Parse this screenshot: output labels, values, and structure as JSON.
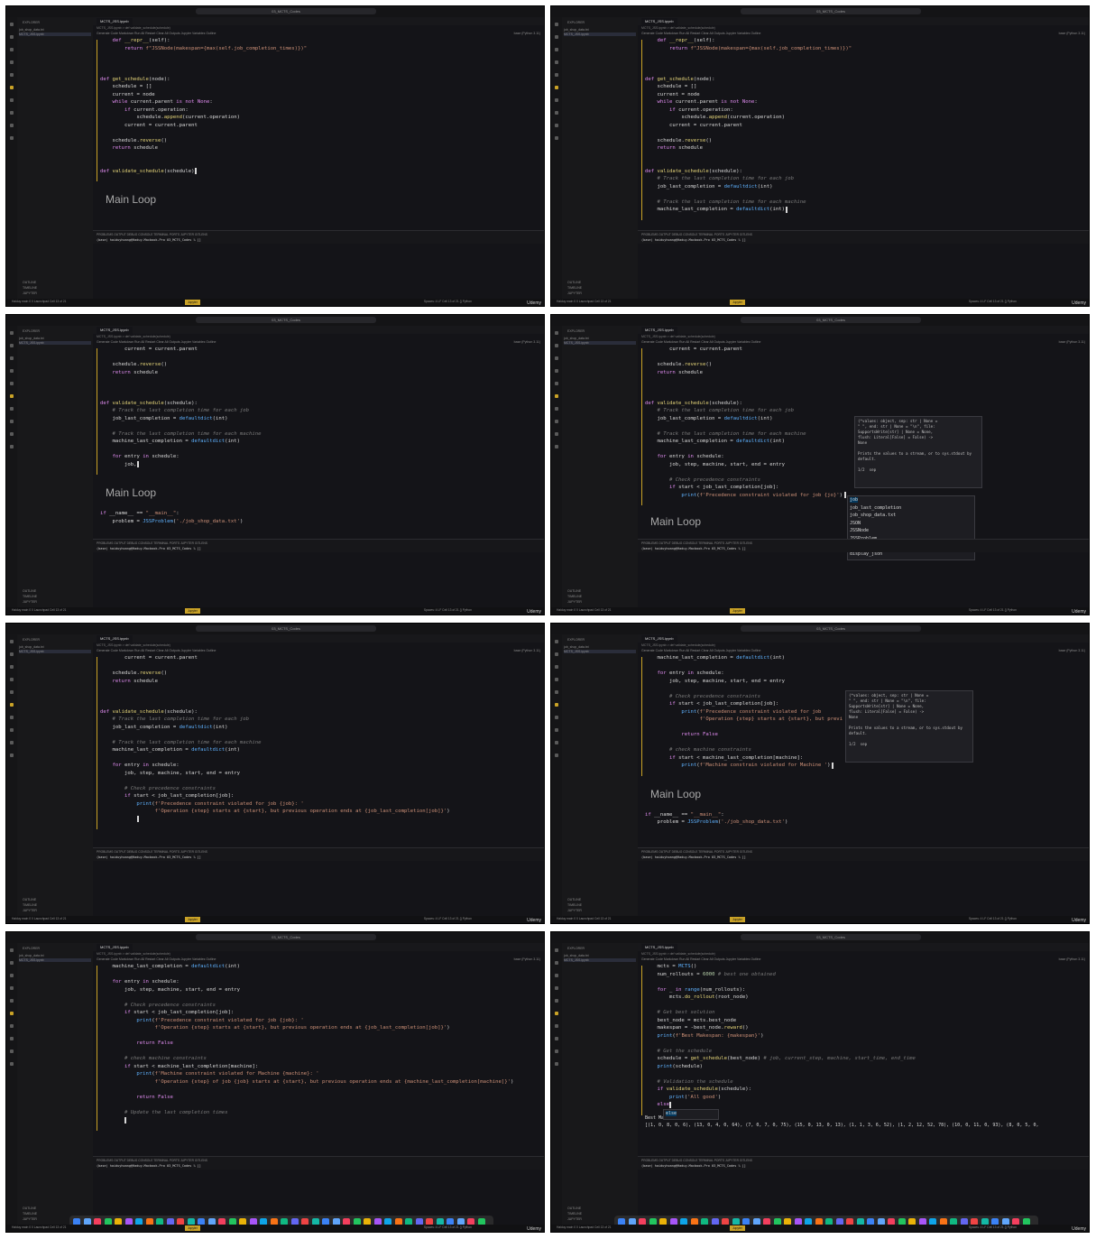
{
  "colors": {
    "accent": "#c9a227",
    "keyword": "#e08cf0",
    "function": "#e6d67a",
    "string": "#e6d67a",
    "comment": "#7a7a7a",
    "variable": "#8ec8f8",
    "builtin": "#5fb2ff"
  },
  "common": {
    "window_title": "03_MCTS_Codes",
    "file_tab": "MCTS_JSS.ipynb",
    "breadcrumb_1": "MCTS_JSS.ipynb > def validate_schedule(schedule)",
    "toolbar": "Generate  Code  Markdown  Run All  Restart  Clear All Outputs  Jupyter Variables  Outline",
    "kernel": "base (Python 3.11)",
    "explorer_title": "EXPLORER",
    "explorer_items": [
      "job_shop_data.txt",
      "MCTS_JSS.ipynb"
    ],
    "side_bottom": [
      "OUTLINE",
      "TIMELINE",
      "JUPYTER"
    ],
    "panel_tabs": "PROBLEMS  OUTPUT  DEBUG CONSOLE  TERMINAL  PORTS  JUPYTER  GITLENS",
    "terminal_prompt": "(base) haiduyhoang@Haduy-Macbook-Pro 03_MCTS_Codes % []",
    "status_left": "Haiduy  main  0  0  Launchpad  Cell 13 of 21",
    "status_badge": "Jupyter",
    "status_right": "Spaces: 4  LF  Cell 13 of 21  {} Python",
    "watermark": "Udemy",
    "markdown_heading": "Main Loop"
  },
  "frames": [
    {
      "lines": [
        "    def __repr__(self):",
        "        return f\"JSSNode(makespan={max(self.job_completion_times)})\"",
        "",
        "",
        "",
        "def get_schedule(node):",
        "    schedule = []",
        "    current = node",
        "    while current.parent is not None:",
        "        if current.operation:",
        "            schedule.append(current.operation)",
        "        current = current.parent",
        "",
        "    schedule.reverse()",
        "    return schedule",
        "",
        "",
        "def validate_schedule(schedule)"
      ]
    },
    {
      "lines": [
        "    def __repr__(self):",
        "        return f\"JSSNode(makespan={max(self.job_completion_times)})\"",
        "",
        "",
        "",
        "def get_schedule(node):",
        "    schedule = []",
        "    current = node",
        "    while current.parent is not None:",
        "        if current.operation:",
        "            schedule.append(current.operation)",
        "        current = current.parent",
        "",
        "    schedule.reverse()",
        "    return schedule",
        "",
        "",
        "def validate_schedule(schedule):",
        "    # Track the last completion time for each job",
        "    job_last_completion = defaultdict(int)",
        "",
        "    # Track the last completion time for each machine",
        "    machine_last_completion = defaultdict(int)"
      ]
    },
    {
      "lines": [
        "        current = current.parent",
        "",
        "    schedule.reverse()",
        "    return schedule",
        "",
        "",
        "",
        "def validate_schedule(schedule):",
        "    # Track the last completion time for each job",
        "    job_last_completion = defaultdict(int)",
        "",
        "    # Track the last completion time for each machine",
        "    machine_last_completion = defaultdict(int)",
        "",
        "    for entry in schedule:",
        "        job,"
      ],
      "after": [
        "if __name__ == \"__main__\":",
        "    problem = JSSProblem('./job_shop_data.txt')"
      ]
    },
    {
      "lines": [
        "        current = current.parent",
        "",
        "    schedule.reverse()",
        "    return schedule",
        "",
        "",
        "",
        "def validate_schedule(schedule):",
        "    # Track the last completion time for each job",
        "    job_last_completion = defaultdict(int)",
        "",
        "    # Track the last completion time for each machine",
        "    machine_last_completion = defaultdict(int)",
        "",
        "    for entry in schedule:",
        "        job, step, machine, start, end = entry",
        "",
        "        # Check precedence constraints",
        "        if start < job_last_completion[job]:",
        "            print(f'Precedence constraint violated for job {jo}')"
      ],
      "hover": "(*values: object, sep: str | None =\n\" \", end: str | None = \"\\n\", file:\nSupportsWrite[str] | None = None,\nflush: Literal[False] = False) ->\nNone\n\nPrints the values to a stream, or to sys.stdout by\ndefault.\n\n1/2  sep",
      "suggestions": [
        "job",
        "job_last_completion",
        "job_shop_data.txt",
        "JSON",
        "JSSNode",
        "JSSProblem",
        "GeoJSON",
        "display_json"
      ]
    },
    {
      "lines": [
        "        current = current.parent",
        "",
        "    schedule.reverse()",
        "    return schedule",
        "",
        "",
        "",
        "def validate_schedule(schedule):",
        "    # Track the last completion time for each job",
        "    job_last_completion = defaultdict(int)",
        "",
        "    # Track the last completion time for each machine",
        "    machine_last_completion = defaultdict(int)",
        "",
        "    for entry in schedule:",
        "        job, step, machine, start, end = entry",
        "",
        "        # Check precedence constraints",
        "        if start < job_last_completion[job]:",
        "            print(f'Precedence constraint violated for job {job}: '",
        "                  f'Operation {step} starts at {start}, but previous operation ends at {job_last_completion[job]}')",
        "            "
      ]
    },
    {
      "lines": [
        "    machine_last_completion = defaultdict(int)",
        "",
        "    for entry in schedule:",
        "        job, step, machine, start, end = entry",
        "",
        "        # Check precedence constraints",
        "        if start < job_last_completion[job]:",
        "            print(f'Precedence constraint violated for job",
        "                  f'Operation {step} starts at {start}, but previ",
        "",
        "            return False",
        "",
        "        # check machine constraints",
        "        if start < machine_last_completion[machine]:",
        "            print(f'Machine constrain violated for Machine ')"
      ],
      "hover": "(*values: object, sep: str | None =\n\" \", end: str | None = \"\\n\", file:\nSupportsWrite[str] | None = None,\nflush: Literal[False] = False) ->\nNone\n\nPrints the values to a stream, or to sys.stdout by\ndefault.\n\n1/2  sep",
      "after": [
        "if __name__ == \"__main__\":",
        "    problem = JSSProblem('./job_shop_data.txt')"
      ]
    },
    {
      "lines": [
        "    machine_last_completion = defaultdict(int)",
        "",
        "    for entry in schedule:",
        "        job, step, machine, start, end = entry",
        "",
        "        # Check precedence constraints",
        "        if start < job_last_completion[job]:",
        "            print(f'Precedence constraint violated for job {job}: '",
        "                  f'Operation {step} starts at {start}, but previous operation ends at {job_last_completion[job]}')",
        "",
        "            return False",
        "",
        "        # check machine constraints",
        "        if start < machine_last_completion[machine]:",
        "            print(f'Machine constraint violated for Machine {machine}: '",
        "                  f'Operation {step} of job {job} starts at {start}, but previous operation ends at {machine_last_completion[machine]}')",
        "",
        "            return False",
        "",
        "        # Update the last completion times",
        "        "
      ]
    },
    {
      "lines": [
        "    mcts = MCTS()",
        "    num_rollouts = 6000 # best one obtained",
        "",
        "    for _ in range(num_rollouts):",
        "        mcts.do_rollout(root_node)",
        "",
        "    # Get best solution",
        "    best_node = mcts.best_node",
        "    makespan = -best_node.reward()",
        "    print(f'Best Makespan: {makespan}')",
        "",
        "    # Get the schedule",
        "    schedule = get_schedule(best_node) # job, current_step, machine, start_time, end_time",
        "    print(schedule)",
        "",
        "    # Validation the schedule",
        "    if validate_schedule(schedule):",
        "        print('All good')",
        "    else"
      ],
      "suggestions": [
        "else"
      ],
      "output": [
        "Best Makespan: 2341",
        "[(1, 0, 8, 0, 6), (13, 0, 4, 0, 64), (7, 0, 7, 0, 75), (15, 0, 13, 0, 13), (1, 1, 3, 6, 52), (1, 2, 12, 52, 78), (10, 0, 11, 0, 93), (8, 0, 5, 0,"
      ]
    }
  ]
}
